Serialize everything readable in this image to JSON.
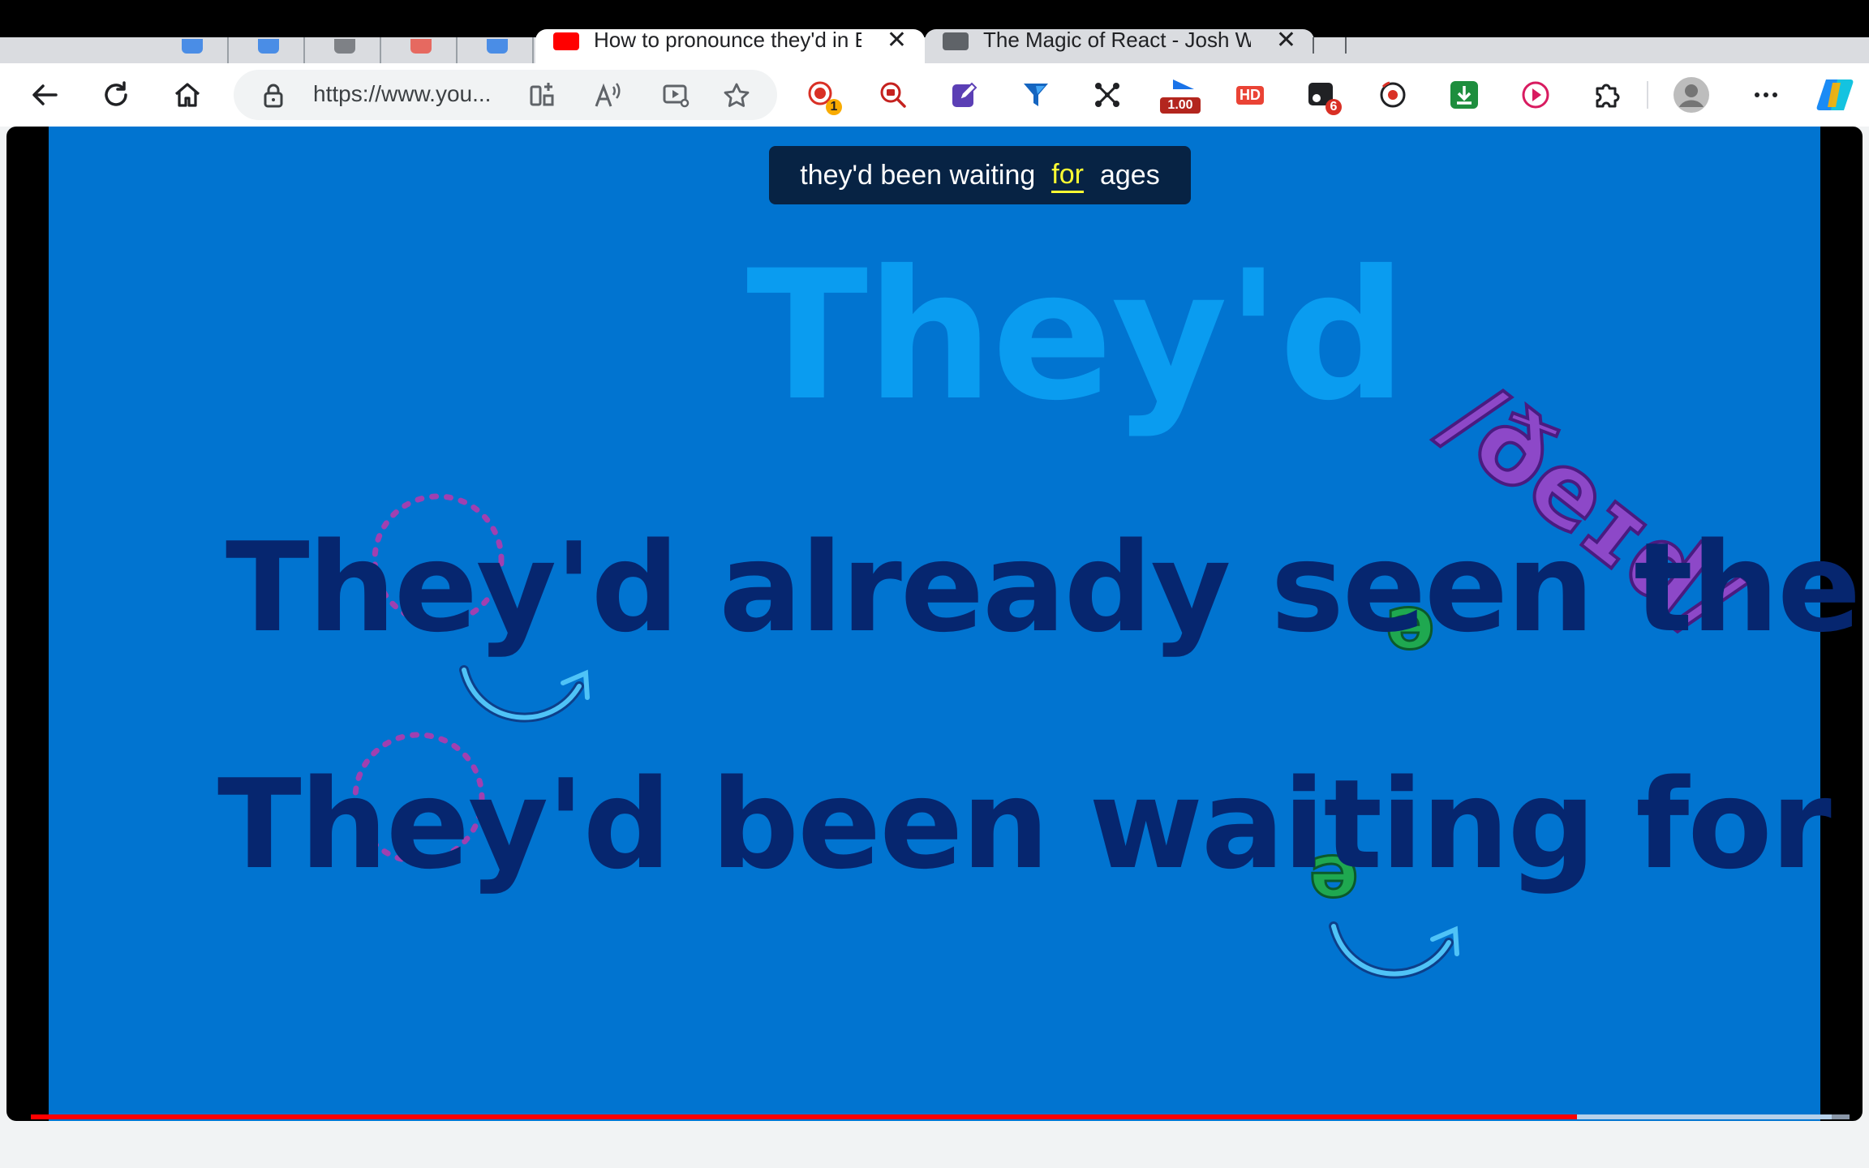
{
  "browser": {
    "tabs": [
      {
        "title": "How to pronounce they'd in En",
        "active": true,
        "favicon": "youtube-icon",
        "color": "#ff0000"
      },
      {
        "title": "The Magic of React - Josh W C",
        "active": false,
        "favicon": "generic-page-icon",
        "color": "#5f6368"
      }
    ],
    "pinned_tabs": [
      {
        "icon": "pinned-tab-icon-1",
        "color": "#1a73e8"
      },
      {
        "icon": "pinned-tab-icon-2",
        "color": "#1a73e8"
      },
      {
        "icon": "pinned-tab-icon-3",
        "color": "#5f6368"
      },
      {
        "icon": "pinned-tab-icon-4",
        "color": "#ea4335"
      },
      {
        "icon": "pinned-tab-icon-5",
        "color": "#1a73e8"
      }
    ],
    "address_bar": {
      "url": "https://www.you..."
    },
    "extensions": {
      "badge_1": "1",
      "rate_label": "1.00",
      "hd_label": "HD",
      "badge_6": "6"
    }
  },
  "video": {
    "caption": {
      "before": "they'd been waiting",
      "highlight": "for",
      "after": "ages"
    },
    "title_word": "They'd",
    "ipa": "/ðeɪd/",
    "sentences": [
      "They'd already seen the film.",
      "They'd been waiting for ages."
    ],
    "schwa_symbol": "ə",
    "progress_played": 0.85,
    "progress_buffered_to": 0.99
  },
  "colors": {
    "video_bg": "#0174d0",
    "title_word": "#0a9cf0",
    "sentence": "#06266f",
    "ipa": "#8d48c8",
    "schwa": "#1fa850",
    "progress": "#ff0000"
  }
}
